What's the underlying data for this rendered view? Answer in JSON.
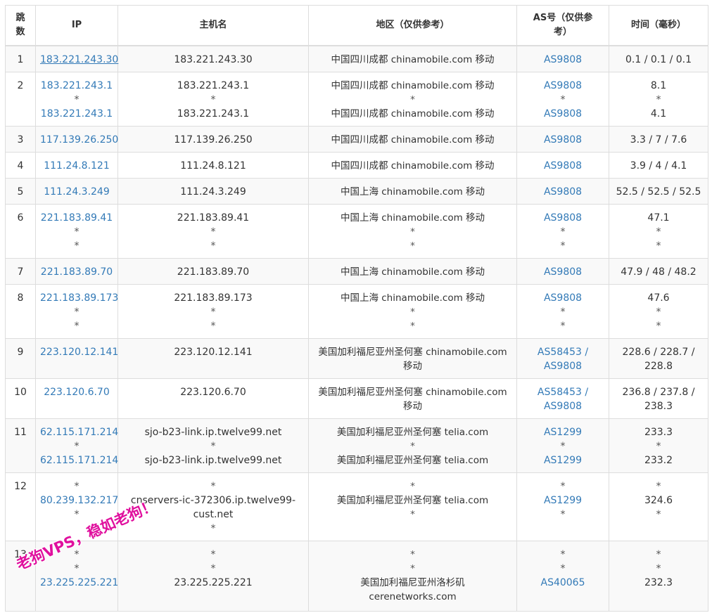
{
  "headers": {
    "hop": "跳数",
    "ip": "IP",
    "host": "主机名",
    "geo": "地区（仅供参考）",
    "as": "AS号（仅供参考）",
    "time": "时间（毫秒）"
  },
  "rows": [
    {
      "hop": "1",
      "ip": [
        "183.221.243.30"
      ],
      "host": [
        "183.221.243.30"
      ],
      "geo": [
        "中国四川成都 chinamobile.com 移动"
      ],
      "as": [
        "AS9808"
      ],
      "time": [
        "0.1 / 0.1 / 0.1"
      ]
    },
    {
      "hop": "2",
      "ip": [
        "183.221.243.1",
        "*",
        "183.221.243.1"
      ],
      "host": [
        "183.221.243.1",
        "*",
        "183.221.243.1"
      ],
      "geo": [
        "中国四川成都 chinamobile.com 移动",
        "*",
        "中国四川成都 chinamobile.com 移动"
      ],
      "as": [
        "AS9808",
        "*",
        "AS9808"
      ],
      "time": [
        "8.1",
        "*",
        "4.1"
      ]
    },
    {
      "hop": "3",
      "ip": [
        "117.139.26.250"
      ],
      "host": [
        "117.139.26.250"
      ],
      "geo": [
        "中国四川成都 chinamobile.com 移动"
      ],
      "as": [
        "AS9808"
      ],
      "time": [
        "3.3 / 7 / 7.6"
      ]
    },
    {
      "hop": "4",
      "ip": [
        "111.24.8.121"
      ],
      "host": [
        "111.24.8.121"
      ],
      "geo": [
        "中国四川成都 chinamobile.com 移动"
      ],
      "as": [
        "AS9808"
      ],
      "time": [
        "3.9 / 4 / 4.1"
      ]
    },
    {
      "hop": "5",
      "ip": [
        "111.24.3.249"
      ],
      "host": [
        "111.24.3.249"
      ],
      "geo": [
        "中国上海 chinamobile.com 移动"
      ],
      "as": [
        "AS9808"
      ],
      "time": [
        "52.5 / 52.5 / 52.5"
      ]
    },
    {
      "hop": "6",
      "ip": [
        "221.183.89.41",
        "*",
        "*"
      ],
      "host": [
        "221.183.89.41",
        "*",
        "*"
      ],
      "geo": [
        "中国上海 chinamobile.com 移动",
        "*",
        "*"
      ],
      "as": [
        "AS9808",
        "*",
        "*"
      ],
      "time": [
        "47.1",
        "*",
        "*"
      ]
    },
    {
      "hop": "7",
      "ip": [
        "221.183.89.70"
      ],
      "host": [
        "221.183.89.70"
      ],
      "geo": [
        "中国上海 chinamobile.com 移动"
      ],
      "as": [
        "AS9808"
      ],
      "time": [
        "47.9 / 48 / 48.2"
      ]
    },
    {
      "hop": "8",
      "ip": [
        "221.183.89.173",
        "*",
        "*"
      ],
      "host": [
        "221.183.89.173",
        "*",
        "*"
      ],
      "geo": [
        "中国上海 chinamobile.com 移动",
        "*",
        "*"
      ],
      "as": [
        "AS9808",
        "*",
        "*"
      ],
      "time": [
        "47.6",
        "*",
        "*"
      ]
    },
    {
      "hop": "9",
      "ip": [
        "223.120.12.141"
      ],
      "host": [
        "223.120.12.141"
      ],
      "geo": [
        "美国加利福尼亚州圣何塞 chinamobile.com",
        "移动"
      ],
      "as": [
        "AS58453 /",
        "AS9808"
      ],
      "time": [
        "228.6 / 228.7 /",
        "228.8"
      ]
    },
    {
      "hop": "10",
      "ip": [
        "223.120.6.70"
      ],
      "host": [
        "223.120.6.70"
      ],
      "geo": [
        "美国加利福尼亚州圣何塞 chinamobile.com",
        "移动"
      ],
      "as": [
        "AS58453 /",
        "AS9808"
      ],
      "time": [
        "236.8 / 237.8 /",
        "238.3"
      ]
    },
    {
      "hop": "11",
      "ip": [
        "62.115.171.214",
        "*",
        "62.115.171.214"
      ],
      "host": [
        "sjo-b23-link.ip.twelve99.net",
        "*",
        "sjo-b23-link.ip.twelve99.net"
      ],
      "geo": [
        "美国加利福尼亚州圣何塞 telia.com",
        "*",
        "美国加利福尼亚州圣何塞 telia.com"
      ],
      "as": [
        "AS1299",
        "*",
        "AS1299"
      ],
      "time": [
        "233.3",
        "*",
        "233.2"
      ]
    },
    {
      "hop": "12",
      "ip": [
        "*",
        "80.239.132.217",
        "*"
      ],
      "host": [
        "*",
        "cnservers-ic-372306.ip.twelve99-",
        "cust.net",
        "*"
      ],
      "geo": [
        "*",
        "美国加利福尼亚州圣何塞 telia.com",
        "*"
      ],
      "as": [
        "*",
        "AS1299",
        "*"
      ],
      "time": [
        "*",
        "324.6",
        "*"
      ]
    },
    {
      "hop": "13",
      "ip": [
        "*",
        "*",
        "23.225.225.221"
      ],
      "host": [
        "*",
        "*",
        "23.225.225.221"
      ],
      "geo": [
        "*",
        "*",
        "美国加利福尼亚州洛杉矶",
        "cerenetworks.com"
      ],
      "as": [
        "*",
        "*",
        "AS40065"
      ],
      "time": [
        "*",
        "*",
        "232.3"
      ]
    }
  ],
  "watermark": "老狗VPS，稳如老狗！",
  "colors": {
    "link": "#337ab7",
    "watermark": "#e0109e",
    "border": "#dddddd",
    "stripe": "#f9f9f9"
  }
}
